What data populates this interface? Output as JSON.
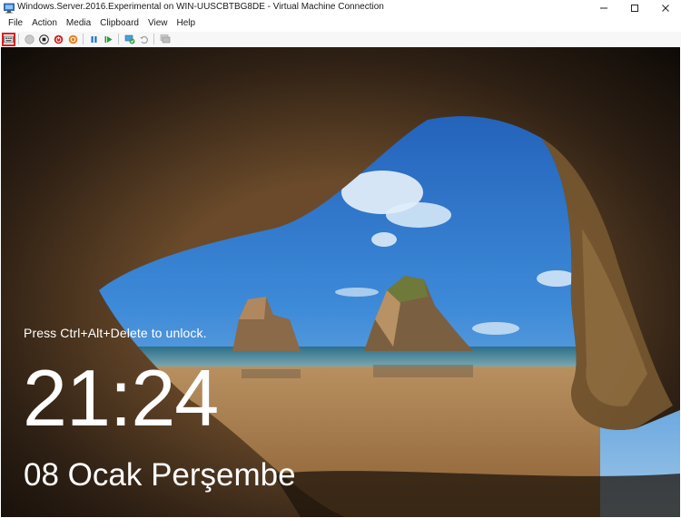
{
  "window": {
    "title": "Windows.Server.2016.Experimental on WIN-UUSCBTBG8DE - Virtual Machine Connection",
    "app_icon": "vm-connection-icon",
    "controls": [
      "minimize-icon",
      "maximize-icon",
      "close-icon"
    ]
  },
  "menu": {
    "items": [
      "File",
      "Action",
      "Media",
      "Clipboard",
      "View",
      "Help"
    ]
  },
  "toolbar": {
    "buttons": [
      {
        "icon": "ctrl-alt-del-icon",
        "active": true
      },
      {
        "icon": "start-icon",
        "active": false
      },
      {
        "icon": "turn-off-icon",
        "active": false
      },
      {
        "icon": "shutdown-icon",
        "active": false
      },
      {
        "icon": "save-icon",
        "active": false
      },
      {
        "icon": "pause-icon",
        "active": false
      },
      {
        "icon": "reset-icon",
        "active": false
      },
      {
        "icon": "checkpoint-icon",
        "active": false
      },
      {
        "icon": "revert-icon",
        "active": false
      },
      {
        "icon": "enhanced-session-icon",
        "active": false
      }
    ],
    "highlight_color": "#e02020"
  },
  "lockscreen": {
    "hint": "Press Ctrl+Alt+Delete to unlock.",
    "time": "21:24",
    "date": "08 Ocak Perşembe"
  }
}
